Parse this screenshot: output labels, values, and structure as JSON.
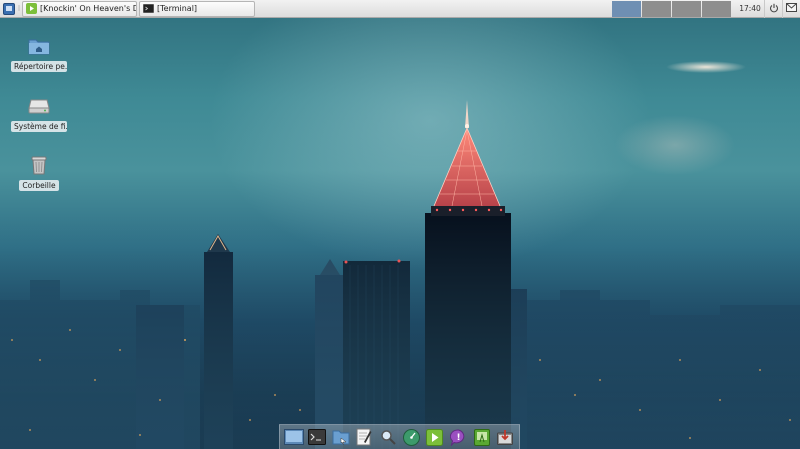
{
  "panel": {
    "tasks": [
      {
        "label": "[Knockin' On Heaven's Doo..."
      },
      {
        "label": "[Terminal]"
      }
    ],
    "workspaces": 4,
    "active_workspace": 1,
    "clock": "17:40",
    "icons": {
      "menu": "app-menu-icon",
      "power": "power-icon",
      "mail": "mail-icon"
    }
  },
  "desktop": {
    "icons": [
      {
        "label": "Répertoire pe...",
        "icon": "home-folder-icon"
      },
      {
        "label": "Système de fi...",
        "icon": "drive-icon"
      },
      {
        "label": "Corbeille",
        "icon": "trash-icon"
      }
    ]
  },
  "dock": {
    "items": [
      {
        "name": "show-desktop-icon"
      },
      {
        "name": "terminal-icon"
      },
      {
        "name": "file-manager-icon"
      },
      {
        "name": "text-editor-icon"
      },
      {
        "name": "search-icon"
      },
      {
        "name": "web-browser-icon"
      },
      {
        "name": "media-player-icon"
      },
      {
        "name": "chat-icon"
      },
      {
        "name": "notes-icon"
      },
      {
        "name": "installer-icon"
      }
    ]
  },
  "colors": {
    "panel_bg": "#e6e6e6",
    "workspace_active": "#6f8fb3",
    "workspace_inactive": "#8e8e8e"
  }
}
